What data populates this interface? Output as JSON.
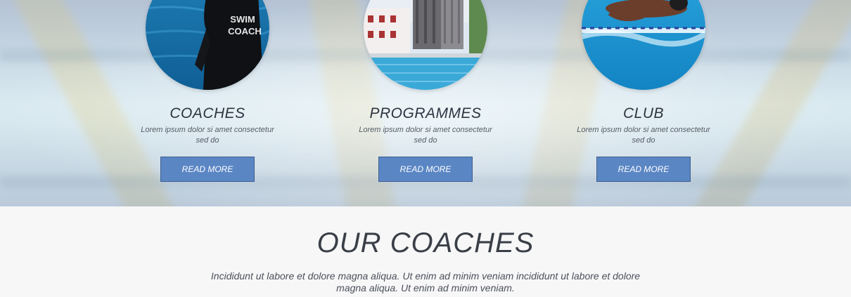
{
  "features": [
    {
      "title": "COACHES",
      "text": "Lorem ipsum dolor si amet consectetur sed do",
      "button": "READ MORE",
      "image_icon": "swim-coach-photo"
    },
    {
      "title": "PROGRAMMES",
      "text": "Lorem ipsum dolor si amet consectetur sed do",
      "button": "READ MORE",
      "image_icon": "pool-building-photo"
    },
    {
      "title": "CLUB",
      "text": "Lorem ipsum dolor si amet consectetur sed do",
      "button": "READ MORE",
      "image_icon": "swimmers-photo"
    }
  ],
  "coach_photo_text": [
    "SWIM",
    "COACH"
  ],
  "our_coaches": {
    "title": "OUR COACHES",
    "text": "Incididunt ut labore et dolore magna aliqua. Ut enim ad minim veniam incididunt ut labore et dolore magna aliqua. Ut enim ad minim veniam."
  },
  "colors": {
    "button_bg": "#5b86c4",
    "button_border": "#3f5f8f",
    "heading": "#2e3440",
    "section_bg": "#f7f7f8"
  }
}
